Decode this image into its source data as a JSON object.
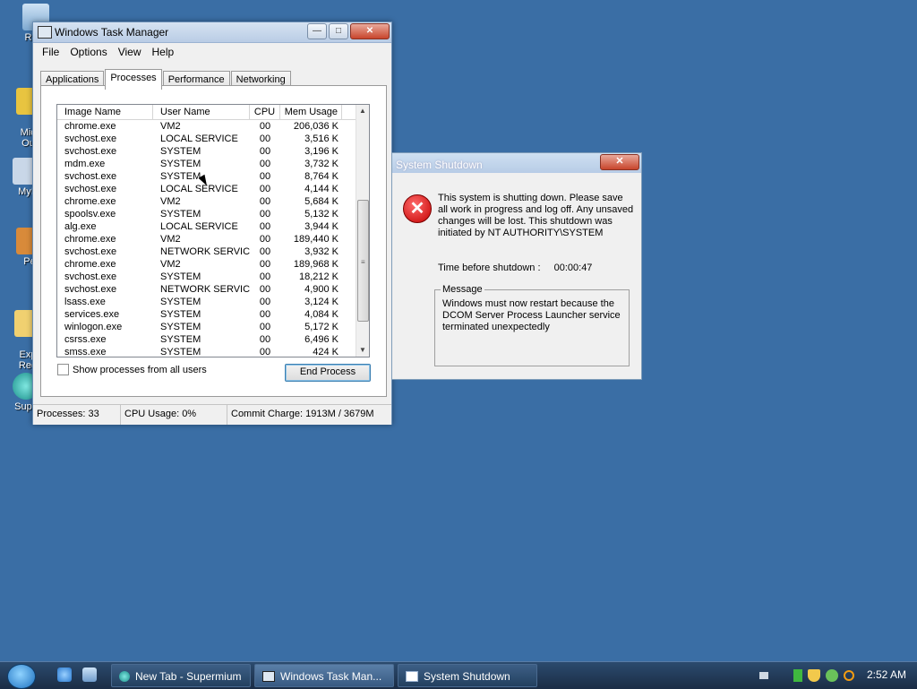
{
  "desktop": {
    "icons": [
      {
        "label": "Recy",
        "icon": "recycle-bin-icon"
      },
      {
        "label": "Micr\nOut",
        "icon": "outlook-icon"
      },
      {
        "label": "MyI",
        "icon": "shortcut-icon"
      },
      {
        "label": "Pe",
        "icon": "shortcut-icon"
      },
      {
        "label": "Exp\nReg",
        "icon": "folder-icon"
      },
      {
        "label": "Supe",
        "icon": "supermium-icon"
      }
    ]
  },
  "task_manager": {
    "title": "Windows Task Manager",
    "menu": [
      "File",
      "Options",
      "View",
      "Help"
    ],
    "tabs": [
      "Applications",
      "Processes",
      "Performance",
      "Networking"
    ],
    "active_tab": "Processes",
    "columns": [
      "Image Name",
      "User Name",
      "CPU",
      "Mem Usage"
    ],
    "processes": [
      [
        "chrome.exe",
        "VM2",
        "00",
        "206,036 K"
      ],
      [
        "svchost.exe",
        "LOCAL SERVICE",
        "00",
        "3,516 K"
      ],
      [
        "svchost.exe",
        "SYSTEM",
        "00",
        "3,196 K"
      ],
      [
        "mdm.exe",
        "SYSTEM",
        "00",
        "3,732 K"
      ],
      [
        "svchost.exe",
        "SYSTEM",
        "00",
        "8,764 K"
      ],
      [
        "svchost.exe",
        "LOCAL SERVICE",
        "00",
        "4,144 K"
      ],
      [
        "chrome.exe",
        "VM2",
        "00",
        "5,684 K"
      ],
      [
        "spoolsv.exe",
        "SYSTEM",
        "00",
        "5,132 K"
      ],
      [
        "alg.exe",
        "LOCAL SERVICE",
        "00",
        "3,944 K"
      ],
      [
        "chrome.exe",
        "VM2",
        "00",
        "189,440 K"
      ],
      [
        "svchost.exe",
        "NETWORK SERVICE",
        "00",
        "3,932 K"
      ],
      [
        "chrome.exe",
        "VM2",
        "00",
        "189,968 K"
      ],
      [
        "svchost.exe",
        "SYSTEM",
        "00",
        "18,212 K"
      ],
      [
        "svchost.exe",
        "NETWORK SERVICE",
        "00",
        "4,900 K"
      ],
      [
        "lsass.exe",
        "SYSTEM",
        "00",
        "3,124 K"
      ],
      [
        "services.exe",
        "SYSTEM",
        "00",
        "4,084 K"
      ],
      [
        "winlogon.exe",
        "SYSTEM",
        "00",
        "5,172 K"
      ],
      [
        "csrss.exe",
        "SYSTEM",
        "00",
        "6,496 K"
      ],
      [
        "smss.exe",
        "SYSTEM",
        "00",
        "424 K"
      ]
    ],
    "show_all_label": "Show processes from all users",
    "end_process_label": "End Process",
    "status": {
      "processes": "Processes: 33",
      "cpu": "CPU Usage: 0%",
      "commit": "Commit Charge: 1913M / 3679M"
    }
  },
  "shutdown_dialog": {
    "title": "System Shutdown",
    "message": "This system is shutting down. Please save all work in progress and log off. Any unsaved changes will be lost. This shutdown was initiated by NT AUTHORITY\\SYSTEM",
    "time_label": "Time before shutdown :",
    "time_value": "00:00:47",
    "group_label": "Message",
    "group_text": "Windows must now restart because the DCOM Server Process Launcher service terminated unexpectedly"
  },
  "taskbar": {
    "buttons": [
      {
        "label": "New Tab - Supermium",
        "icon": "browser-icon"
      },
      {
        "label": "Windows Task Man...",
        "icon": "task-manager-icon"
      },
      {
        "label": "System Shutdown",
        "icon": "window-icon"
      }
    ],
    "clock": "2:52 AM"
  },
  "colors": {
    "desktop": "#3a6ea5",
    "error": "#c40000"
  }
}
